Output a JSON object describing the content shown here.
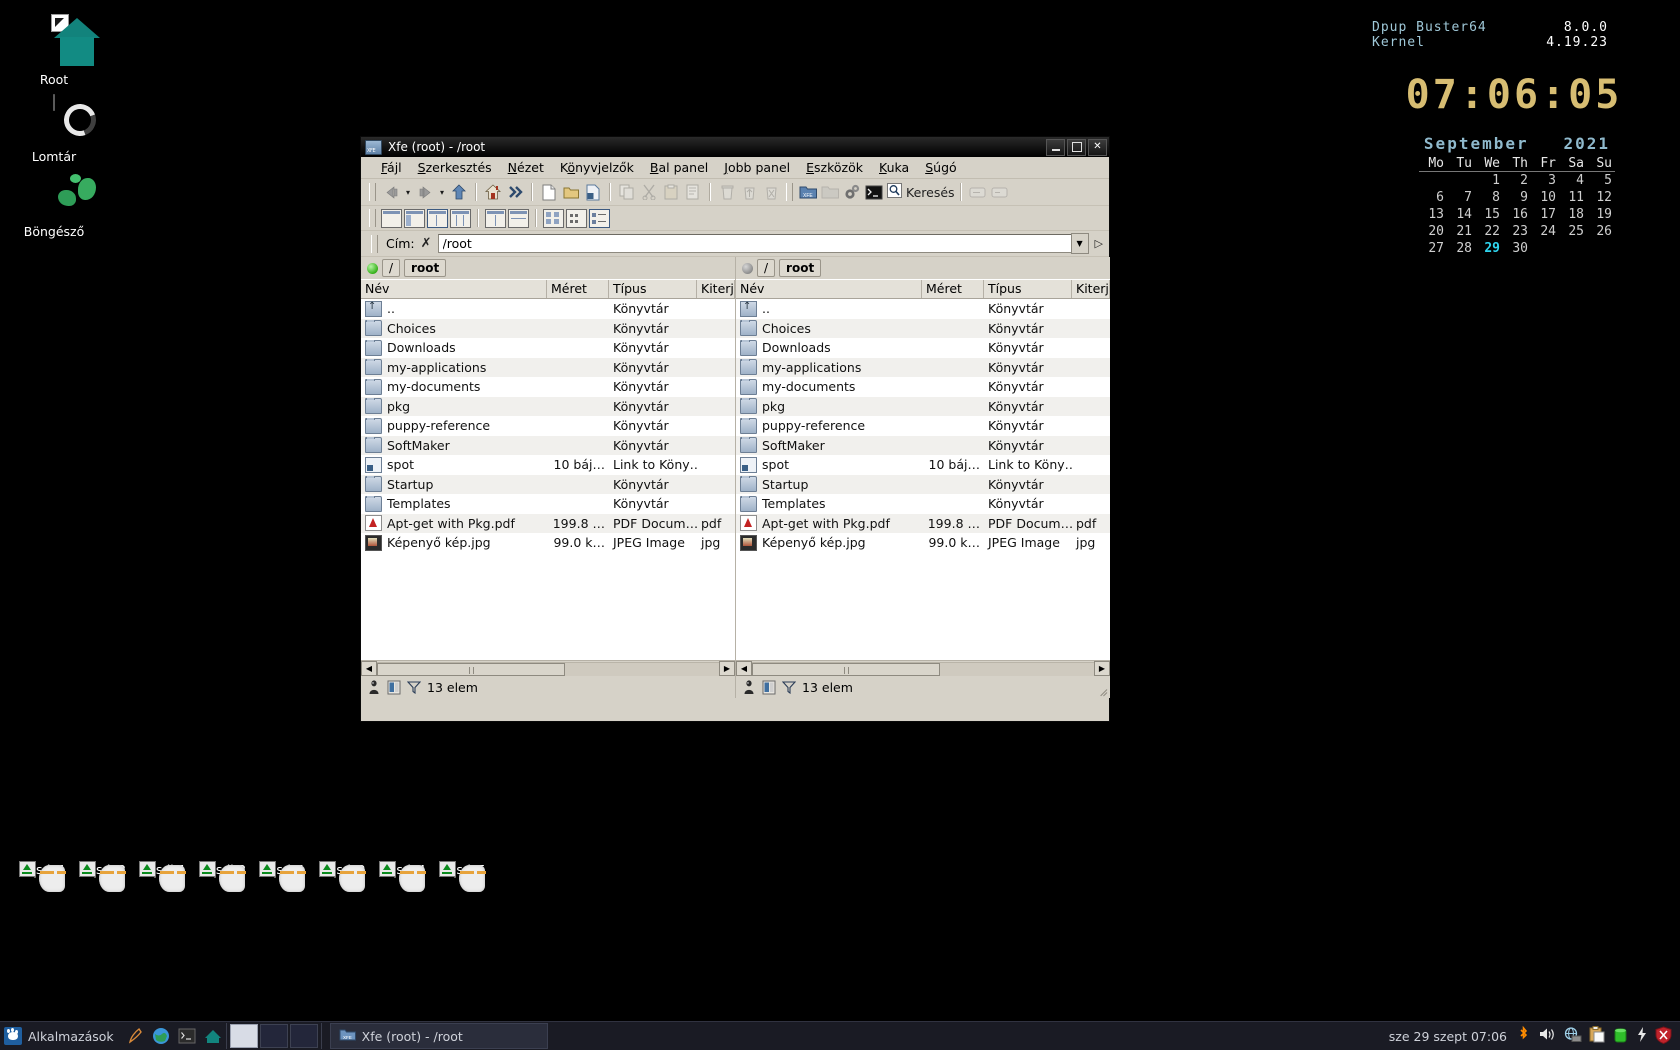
{
  "desktop": {
    "icons": [
      {
        "label": "Root",
        "icon": "home-folder-icon"
      },
      {
        "label": "Lomtár",
        "icon": "trash-icon"
      },
      {
        "label": "Böngésző",
        "icon": "globe-browser-icon"
      }
    ],
    "drives": [
      {
        "label": "sda1"
      },
      {
        "label": "sda2"
      },
      {
        "label": "sdb1"
      },
      {
        "label": "sdb2"
      },
      {
        "label": "sdc1"
      },
      {
        "label": "sdc2"
      },
      {
        "label": "sdc4"
      },
      {
        "label": "sdc5"
      }
    ]
  },
  "conky": {
    "distro_key": "Dpup Buster64",
    "distro_value": "8.0.0",
    "kernel_key": "Kernel",
    "kernel_value": "4.19.23",
    "clock": "07:06:05",
    "calendar": {
      "month": "September",
      "year": "2021",
      "weekdays": [
        "Mo",
        "Tu",
        "We",
        "Th",
        "Fr",
        "Sa",
        "Su"
      ],
      "weeks": [
        [
          "",
          "",
          "1",
          "2",
          "3",
          "4",
          "5"
        ],
        [
          "6",
          "7",
          "8",
          "9",
          "10",
          "11",
          "12"
        ],
        [
          "13",
          "14",
          "15",
          "16",
          "17",
          "18",
          "19"
        ],
        [
          "20",
          "21",
          "22",
          "23",
          "24",
          "25",
          "26"
        ],
        [
          "27",
          "28",
          "29",
          "30",
          "",
          "",
          ""
        ]
      ],
      "today": "29"
    }
  },
  "window": {
    "title": "Xfe (root) - /root",
    "minimize_label": "—",
    "maximize_label": "□",
    "close_label": "✕",
    "menu": [
      "Fájl",
      "Szerkesztés",
      "Nézet",
      "Könyvjelzők",
      "Bal panel",
      "Jobb panel",
      "Eszközök",
      "Kuka",
      "Súgó"
    ],
    "toolbar_search_label": "Keresés",
    "address": {
      "label": "Cím:",
      "clear_label": "✗",
      "value": "/root",
      "placeholder": "/root"
    },
    "columns": [
      "Név",
      "Méret",
      "Típus",
      "Kiterj"
    ],
    "left_panel": {
      "crumb_root": "/",
      "crumb_dir": "root",
      "status": "13 elem",
      "active": true
    },
    "right_panel": {
      "crumb_root": "/",
      "crumb_dir": "root",
      "status": "13 elem",
      "active": false
    },
    "files": [
      {
        "name": "..",
        "size": "",
        "type": "Könyvtár",
        "ext": "",
        "icon": "parent-folder-icon"
      },
      {
        "name": "Choices",
        "size": "",
        "type": "Könyvtár",
        "ext": "",
        "icon": "folder-icon"
      },
      {
        "name": "Downloads",
        "size": "",
        "type": "Könyvtár",
        "ext": "",
        "icon": "folder-icon"
      },
      {
        "name": "my-applications",
        "size": "",
        "type": "Könyvtár",
        "ext": "",
        "icon": "folder-icon"
      },
      {
        "name": "my-documents",
        "size": "",
        "type": "Könyvtár",
        "ext": "",
        "icon": "folder-icon"
      },
      {
        "name": "pkg",
        "size": "",
        "type": "Könyvtár",
        "ext": "",
        "icon": "folder-icon"
      },
      {
        "name": "puppy-reference",
        "size": "",
        "type": "Könyvtár",
        "ext": "",
        "icon": "folder-icon"
      },
      {
        "name": "SoftMaker",
        "size": "",
        "type": "Könyvtár",
        "ext": "",
        "icon": "folder-icon"
      },
      {
        "name": "spot",
        "size": "10 báj…",
        "type": "Link to Köny…",
        "ext": "",
        "icon": "symlink-icon"
      },
      {
        "name": "Startup",
        "size": "",
        "type": "Könyvtár",
        "ext": "",
        "icon": "folder-icon"
      },
      {
        "name": "Templates",
        "size": "",
        "type": "Könyvtár",
        "ext": "",
        "icon": "folder-icon"
      },
      {
        "name": "Apt-get with Pkg.pdf",
        "size": "199.8 …",
        "type": "PDF Docum…",
        "ext": "pdf",
        "icon": "pdf-file-icon"
      },
      {
        "name": "Képenyő kép.jpg",
        "size": "99.0 k…",
        "type": "JPEG Image",
        "ext": "jpg",
        "icon": "image-file-icon"
      }
    ]
  },
  "taskbar": {
    "menu_label": "Alkalmazások",
    "task_label": "Xfe (root) - /root",
    "clock": "sze 29 szept 07:06"
  },
  "colors": {
    "desktop_bg": "#000000",
    "window_face": "#d6d2c8",
    "taskbar_bg": "#1a1b24",
    "accent_today": "#2fd5ef",
    "conky_clock": "#d7bd72"
  }
}
